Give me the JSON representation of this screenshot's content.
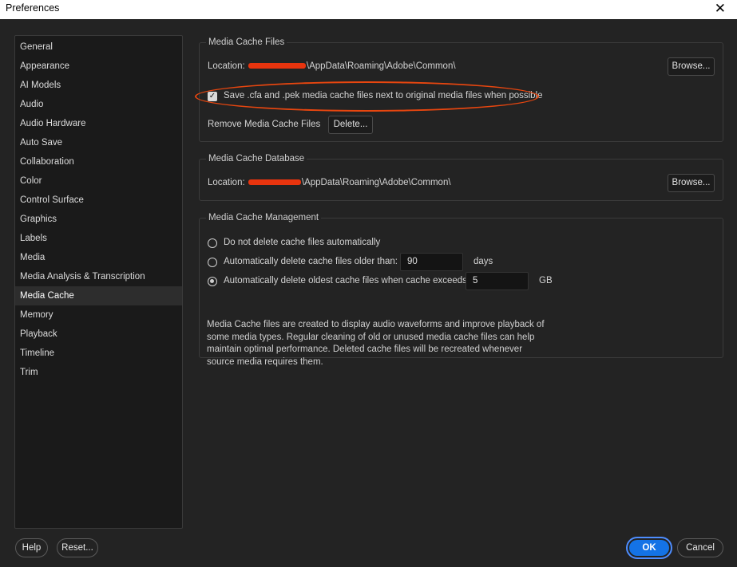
{
  "window": {
    "title": "Preferences",
    "close_glyph": "✕"
  },
  "sidebar": {
    "items": [
      {
        "label": "General"
      },
      {
        "label": "Appearance"
      },
      {
        "label": "AI Models"
      },
      {
        "label": "Audio"
      },
      {
        "label": "Audio Hardware"
      },
      {
        "label": "Auto Save"
      },
      {
        "label": "Collaboration"
      },
      {
        "label": "Color"
      },
      {
        "label": "Control Surface"
      },
      {
        "label": "Graphics"
      },
      {
        "label": "Labels"
      },
      {
        "label": "Media"
      },
      {
        "label": "Media Analysis & Transcription"
      },
      {
        "label": "Media Cache",
        "selected": true
      },
      {
        "label": "Memory"
      },
      {
        "label": "Playback"
      },
      {
        "label": "Timeline"
      },
      {
        "label": "Trim"
      }
    ]
  },
  "cache_files": {
    "legend": "Media Cache Files",
    "location_label": "Location:",
    "location_path": "\\AppData\\Roaming\\Adobe\\Common\\",
    "browse_label": "Browse...",
    "save_next_checked": true,
    "save_next_label": "Save .cfa and .pek media cache files next to original media files when possible",
    "remove_label": "Remove Media Cache Files",
    "delete_label": "Delete..."
  },
  "cache_database": {
    "legend": "Media Cache Database",
    "location_label": "Location:",
    "location_path": "\\AppData\\Roaming\\Adobe\\Common\\",
    "browse_label": "Browse..."
  },
  "cache_management": {
    "legend": "Media Cache Management",
    "option_never": "Do not delete cache files automatically",
    "option_older": "Automatically delete cache files older than:",
    "older_value": "90",
    "older_unit": "days",
    "option_exceeds": "Automatically delete oldest cache files when cache exceeds:",
    "exceeds_value": "5",
    "exceeds_unit": "GB",
    "selected_option": "exceeds",
    "description": "Media Cache files are created to display audio waveforms and improve playback of some media types.  Regular cleaning of old or unused media cache files can help maintain optimal performance. Deleted cache files will be recreated whenever source media requires them."
  },
  "footer": {
    "help_label": "Help",
    "reset_label": "Reset...",
    "ok_label": "OK",
    "cancel_label": "Cancel"
  },
  "colors": {
    "accent": "#1473e6",
    "highlight_annotation": "#e8460f",
    "redaction": "#e8340e"
  }
}
